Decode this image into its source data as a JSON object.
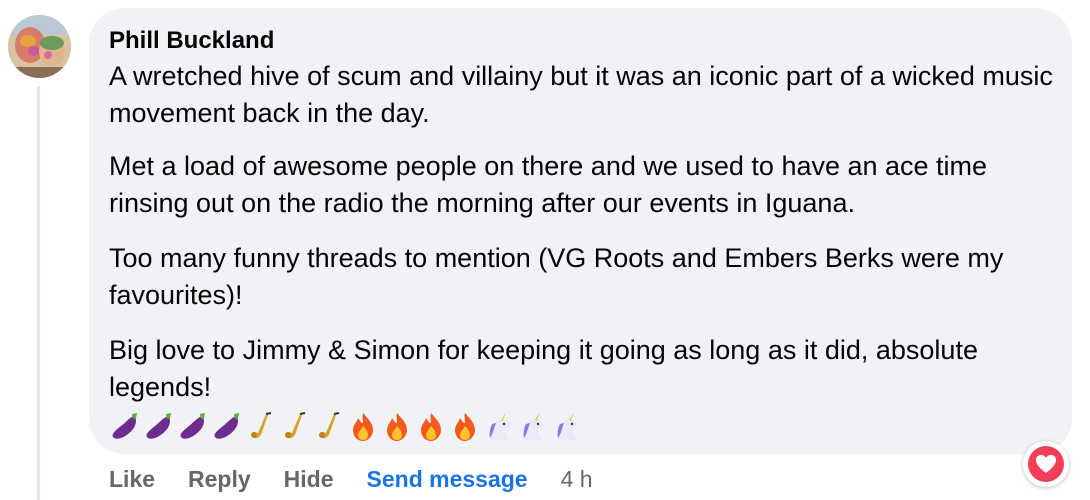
{
  "comment": {
    "author": "Phill Buckland",
    "paragraphs": [
      "A wretched hive of scum and villainy but it was an iconic part of a wicked music movement back in the day.",
      "Met a load of awesome people on there and we used to have an ace time rinsing out on the radio the morning after our events in Iguana.",
      "Too many funny threads to mention (VG Roots and Embers Berks were my favourites)!",
      "Big love to Jimmy & Simon for keeping it going as long as it did, absolute legends!"
    ],
    "emoji_row": [
      "eggplant-icon",
      "eggplant-icon",
      "eggplant-icon",
      "eggplant-icon",
      "saxophone-icon",
      "saxophone-icon",
      "saxophone-icon",
      "fire-icon",
      "fire-icon",
      "fire-icon",
      "fire-icon",
      "unicorn-icon",
      "unicorn-icon",
      "unicorn-icon"
    ]
  },
  "actions": {
    "like": "Like",
    "reply": "Reply",
    "hide": "Hide",
    "send_message": "Send message",
    "time": "4 h"
  },
  "reaction": {
    "icon": "heart-icon",
    "color": "#f33e58"
  },
  "colors": {
    "bubble": "#f0f2f5",
    "link": "#1b74e4",
    "muted": "#65676b"
  }
}
